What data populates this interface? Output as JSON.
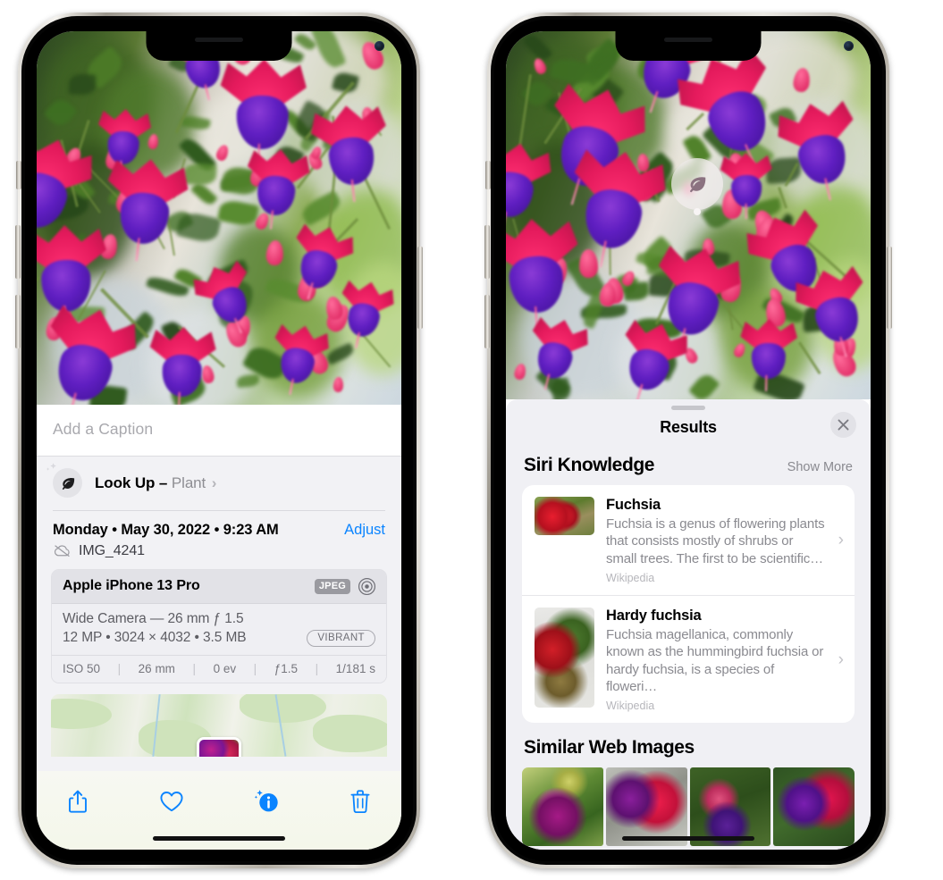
{
  "left_phone": {
    "photo": {
      "alt": "fuchsia-flowers-photo"
    },
    "caption": {
      "placeholder": "Add a Caption",
      "value": ""
    },
    "lookup": {
      "icon": "leaf-icon",
      "sparkle_icon": "sparkles-icon",
      "label": "Look Up –",
      "subject": "Plant",
      "chevron": "›"
    },
    "metadata": {
      "date": "Monday • May 30, 2022 • 9:23 AM",
      "adjust_label": "Adjust",
      "cloud_icon": "cloud-slash-icon",
      "filename": "IMG_4241"
    },
    "exif": {
      "device": "Apple iPhone 13 Pro",
      "format_chip": "JPEG",
      "raw_icon": "raw-aperture-icon",
      "lens": "Wide Camera — 26 mm ƒ 1.5",
      "size_line": "12 MP  •  3024 × 4032  •  3.5 MB",
      "style_chip": "VIBRANT",
      "stats": [
        "ISO 50",
        "26 mm",
        "0 ev",
        "ƒ1.5",
        "1/181 s"
      ]
    },
    "map": {
      "name": "location-map-thumbnail",
      "pin": "photo-pin"
    },
    "toolbar": [
      {
        "name": "share-button",
        "icon": "share-icon"
      },
      {
        "name": "favorite-button",
        "icon": "heart-icon"
      },
      {
        "name": "info-button",
        "icon": "info-sparkle-icon"
      },
      {
        "name": "delete-button",
        "icon": "trash-icon"
      }
    ]
  },
  "right_phone": {
    "photo": {
      "alt": "fuchsia-flowers-photo"
    },
    "lookup_pin": {
      "icon": "leaf-icon"
    },
    "sheet": {
      "grabber": "sheet-grabber",
      "title": "Results",
      "close_icon": "close-icon"
    },
    "siri_knowledge": {
      "title": "Siri Knowledge",
      "action": "Show More",
      "items": [
        {
          "title": "Fuchsia",
          "description": "Fuchsia is a genus of flowering plants that consists mostly of shrubs or small trees. The first to be scientific…",
          "source": "Wikipedia",
          "thumb": "fuchsia-red-flowers-thumb",
          "chevron": "›"
        },
        {
          "title": "Hardy fuchsia",
          "description": "Fuchsia magellanica, commonly known as the hummingbird fuchsia or hardy fuchsia, is a species of floweri…",
          "source": "Wikipedia",
          "thumb": "hardy-fuchsia-branch-thumb",
          "chevron": "›"
        }
      ]
    },
    "similar_web_images": {
      "title": "Similar Web Images",
      "thumbs": [
        "web-image-1",
        "web-image-2",
        "web-image-3",
        "web-image-4"
      ]
    }
  },
  "colors": {
    "accent_blue": "#0a84ff",
    "sheet_bg": "#f0f0f4",
    "card_bg": "#ffffff",
    "secondary_text": "#8a8a90"
  }
}
